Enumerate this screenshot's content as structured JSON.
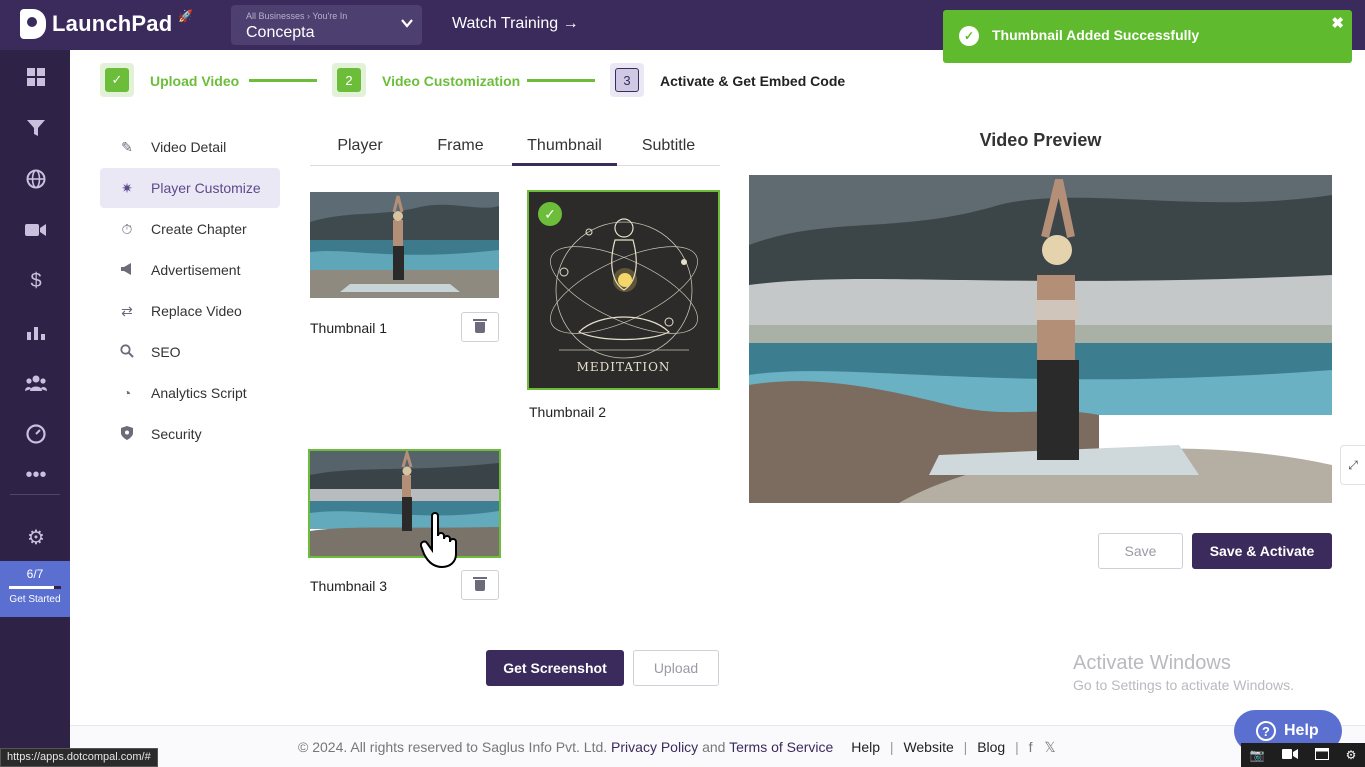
{
  "app": {
    "name": "LaunchPad",
    "business_crumb": "All Businesses  ›  You're In",
    "business_name": "Concepta",
    "watch_training": "Watch Training →"
  },
  "rail": {
    "icons": [
      "dashboard-icon",
      "funnel-icon",
      "globe-icon",
      "video-camera-icon",
      "dollar-icon",
      "chart-icon",
      "users-icon",
      "gauge-icon",
      "more-icon",
      "gear-icon"
    ],
    "get_started_progress": "6/7",
    "get_started_fraction": 0.857,
    "get_started_label": "Get Started"
  },
  "stepper": {
    "steps": [
      {
        "label": "Upload Video",
        "marker": "✓",
        "state": "done"
      },
      {
        "label": "Video Customization",
        "marker": "2",
        "state": "active"
      },
      {
        "label": "Activate & Get Embed Code",
        "marker": "3",
        "state": "pending"
      }
    ]
  },
  "subnav": {
    "items": [
      {
        "label": "Video Detail",
        "icon": "edit-icon",
        "glyph": "✎"
      },
      {
        "label": "Player Customize",
        "icon": "wand-icon",
        "glyph": "✷"
      },
      {
        "label": "Create Chapter",
        "icon": "stopwatch-icon",
        "glyph": "⏱"
      },
      {
        "label": "Advertisement",
        "icon": "megaphone-icon",
        "glyph": "📢"
      },
      {
        "label": "Replace Video",
        "icon": "swap-icon",
        "glyph": "⇄"
      },
      {
        "label": "SEO",
        "icon": "magnifier-icon",
        "glyph": "🔍"
      },
      {
        "label": "Analytics Script",
        "icon": "pie-chart-icon",
        "glyph": "◔"
      },
      {
        "label": "Security",
        "icon": "shield-icon",
        "glyph": "⛨"
      }
    ],
    "active_index": 1
  },
  "tabs": [
    "Player",
    "Frame",
    "Thumbnail",
    "Subtitle"
  ],
  "active_tab": "Thumbnail",
  "thumbnails": [
    {
      "label": "Thumbnail 1"
    },
    {
      "label": "Thumbnail 2",
      "overlay_text": "MEDITATION"
    },
    {
      "label": "Thumbnail 3"
    }
  ],
  "actions": {
    "get_screenshot": "Get Screenshot",
    "upload": "Upload",
    "save": "Save",
    "save_activate": "Save & Activate"
  },
  "preview": {
    "title": "Video Preview"
  },
  "toast": {
    "message": "Thumbnail Added Successfully",
    "close": "✖"
  },
  "windows_watermark": {
    "title": "Activate Windows",
    "subtitle": "Go to Settings to activate Windows."
  },
  "footer": {
    "copyright": "©  2024. All rights reserved to Saglus Info Pvt. Ltd.",
    "privacy": "Privacy Policy",
    "and": "and",
    "terms": "Terms of Service",
    "help": "Help",
    "website": "Website",
    "blog": "Blog",
    "social_facebook": "f",
    "social_x": "𝕏"
  },
  "help_button": {
    "label": "Help",
    "glyph": "?"
  },
  "status_url": "https://apps.dotcompal.com/#",
  "colors": {
    "primary": "#3a2b5c",
    "success": "#6cbe3a",
    "toast": "#5fbb2d",
    "accent": "#5a6fd0"
  }
}
